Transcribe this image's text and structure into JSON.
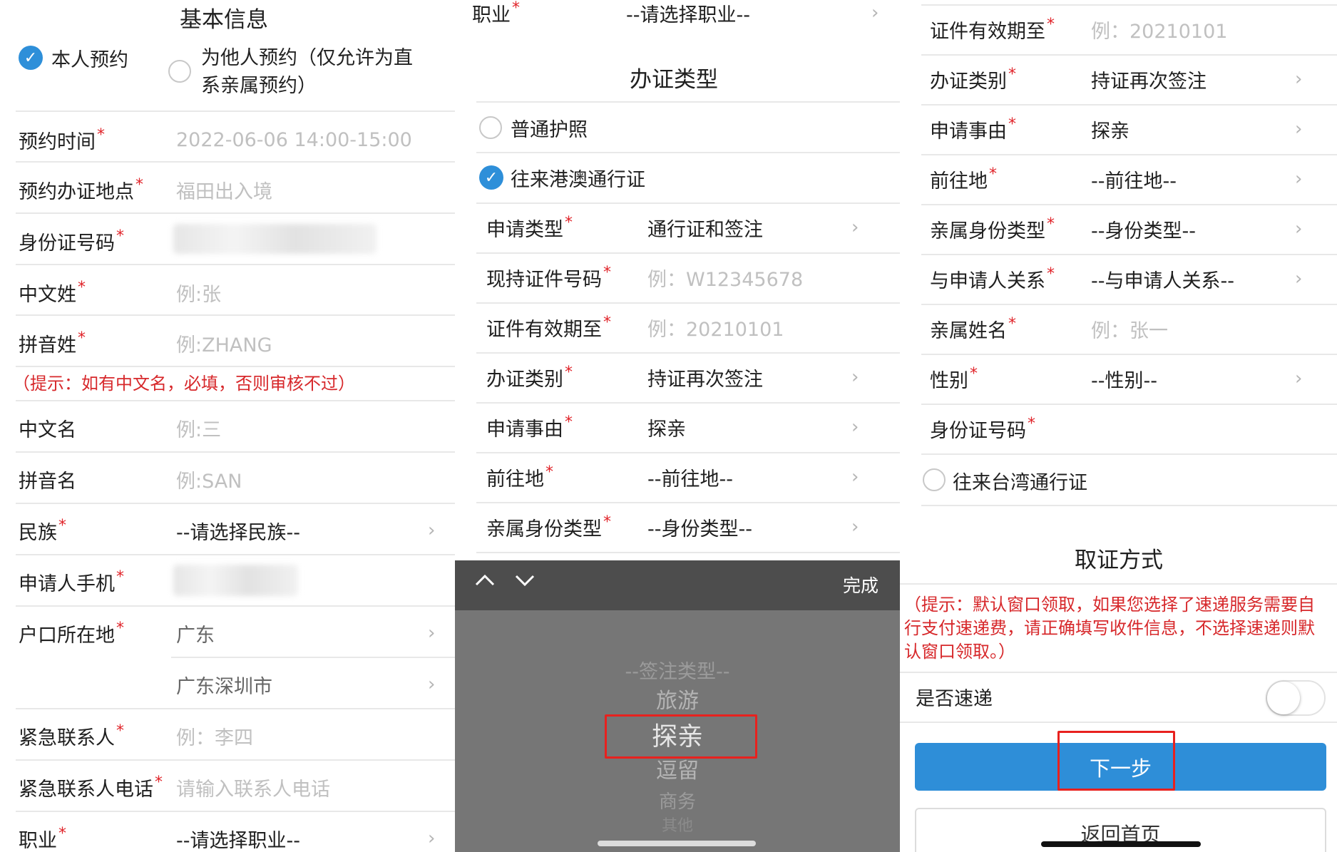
{
  "panel1": {
    "title": "基本信息",
    "self_booking": "本人预约",
    "other_booking": "为他人预约（仅允许为直",
    "other_booking_line2": "系亲属预约）",
    "fields": [
      {
        "label": "预约时间",
        "value": "2022-06-06 14:00-15:00"
      },
      {
        "label": "预约办证地点",
        "value": "福田出入境"
      },
      {
        "label": "身份证号码",
        "value": ""
      },
      {
        "label": "中文姓",
        "placeholder": "例:张"
      },
      {
        "label": "拼音姓",
        "placeholder": "例:ZHANG"
      }
    ],
    "hint": "（提示：如有中文名，必填，否则审核不过）",
    "fields2": [
      {
        "label": "中文名",
        "placeholder": "例:三"
      },
      {
        "label": "拼音名",
        "placeholder": "例:SAN"
      },
      {
        "label": "民族",
        "value": "--请选择民族--"
      },
      {
        "label": "申请人手机",
        "value": ""
      },
      {
        "label": "户口所在地",
        "value": "广东"
      },
      {
        "label": "",
        "value": "广东深圳市"
      },
      {
        "label": "紧急联系人",
        "placeholder": "例：李四"
      },
      {
        "label": "紧急联系人电话",
        "placeholder": "请输入联系人电话"
      },
      {
        "label": "职业",
        "value": "--请选择职业--"
      }
    ]
  },
  "panel2": {
    "occupation_label": "职业",
    "occupation_value": "--请选择职业--",
    "section_title": "办证类型",
    "option_passport": "普通护照",
    "option_hk_macau": "往来港澳通行证",
    "fields": [
      {
        "label": "申请类型",
        "value": "通行证和签注"
      },
      {
        "label": "现持证件号码",
        "placeholder": "例：W12345678"
      },
      {
        "label": "证件有效期至",
        "placeholder": "例：20210101"
      },
      {
        "label": "办证类别",
        "value": "持证再次签注"
      },
      {
        "label": "申请事由",
        "value": "探亲"
      },
      {
        "label": "前往地",
        "value": "--前往地--"
      },
      {
        "label": "亲属身份类型",
        "value": "--身份类型--"
      }
    ],
    "picker": {
      "done": "完成",
      "options": [
        "--签注类型--",
        "旅游",
        "探亲",
        "逗留",
        "商务",
        "其他"
      ]
    }
  },
  "panel3": {
    "fields": [
      {
        "label": "证件有效期至",
        "placeholder": "例：20210101"
      },
      {
        "label": "办证类别",
        "value": "持证再次签注"
      },
      {
        "label": "申请事由",
        "value": "探亲"
      },
      {
        "label": "前往地",
        "value": "--前往地--"
      },
      {
        "label": "亲属身份类型",
        "value": "--身份类型--"
      },
      {
        "label": "与申请人关系",
        "value": "--与申请人关系--"
      },
      {
        "label": "亲属姓名",
        "placeholder": "例：张一"
      },
      {
        "label": "性别",
        "value": "--性别--"
      },
      {
        "label": "身份证号码",
        "value": ""
      }
    ],
    "option_taiwan": "往来台湾通行证",
    "section_title": "取证方式",
    "hint_line1": "（提示：默认窗口领取，如果您选择了速递服务需要自",
    "hint_line2": "行支付速递费，请正确填写收件信息，不选择速递则默",
    "hint_line3": "认窗口领取。）",
    "express_label": "是否速递",
    "next_button": "下一步",
    "home_button": "返回首页"
  },
  "icons": {
    "check": "check-icon",
    "chevron": "chevron-right-icon",
    "up": "chevron-up-icon",
    "down": "chevron-down-icon"
  },
  "colors": {
    "accent": "#2e8fd9",
    "required": "#e0242a",
    "highlight": "#e8211e"
  }
}
